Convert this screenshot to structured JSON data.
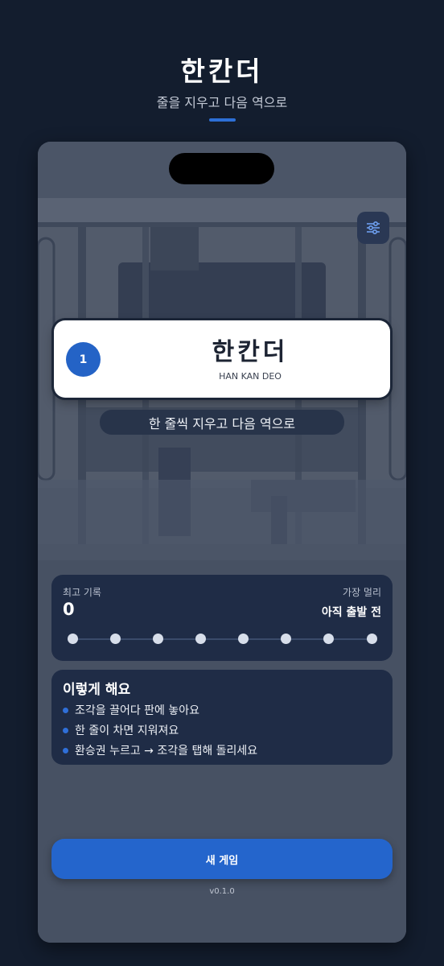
{
  "header": {
    "title": "한칸더",
    "subtitle": "줄을 지우고 다음 역으로"
  },
  "colors": {
    "background": "#131d2e",
    "accent": "#2465cc",
    "card": "#1f2c46",
    "station_card": "#ffffff"
  },
  "station": {
    "number": "1",
    "name": "한칸더",
    "romanized": "HAN KAN DEO",
    "tagline": "한 줄씩 지우고 다음 역으로"
  },
  "record": {
    "best_label": "최고 기록",
    "best_value": "0",
    "farthest_label": "가장 멀리",
    "farthest_value": "아직 출발 전",
    "stations_total": 8
  },
  "howto": {
    "title": "이렇게 해요",
    "items": [
      "조각을 끌어다 판에 놓아요",
      "한 줄이 차면 지워져요",
      "환승권 누르고 → 조각을 탭해 돌리세요"
    ]
  },
  "actions": {
    "new_game": "새 게임",
    "settings_icon": "sliders-icon"
  },
  "version": "v0.1.0"
}
